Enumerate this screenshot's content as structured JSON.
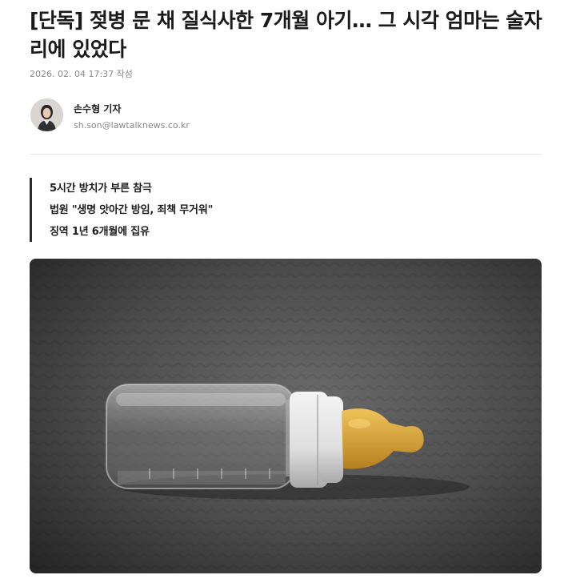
{
  "article": {
    "headline": "[단독] 젖병 문 채 질식사한 7개월 아기… 그 시각 엄마는 술자리에 있었다",
    "dateline": "2026. 02. 04 17:37 작성"
  },
  "author": {
    "name": "손수형 기자",
    "email": "sh.son@lawtalknews.co.kr",
    "avatar_icon": "reporter-avatar"
  },
  "summary": {
    "lines": [
      "5시간 방치가 부른 참극",
      "법원 \"생명 앗아간 방임, 죄책 무거워\"",
      "징역 1년 6개월에 집유"
    ]
  },
  "photo": {
    "subject_icon": "baby-bottle-photo",
    "background_color": "#4a4a4a",
    "nipple_color": "#d9a53a"
  }
}
